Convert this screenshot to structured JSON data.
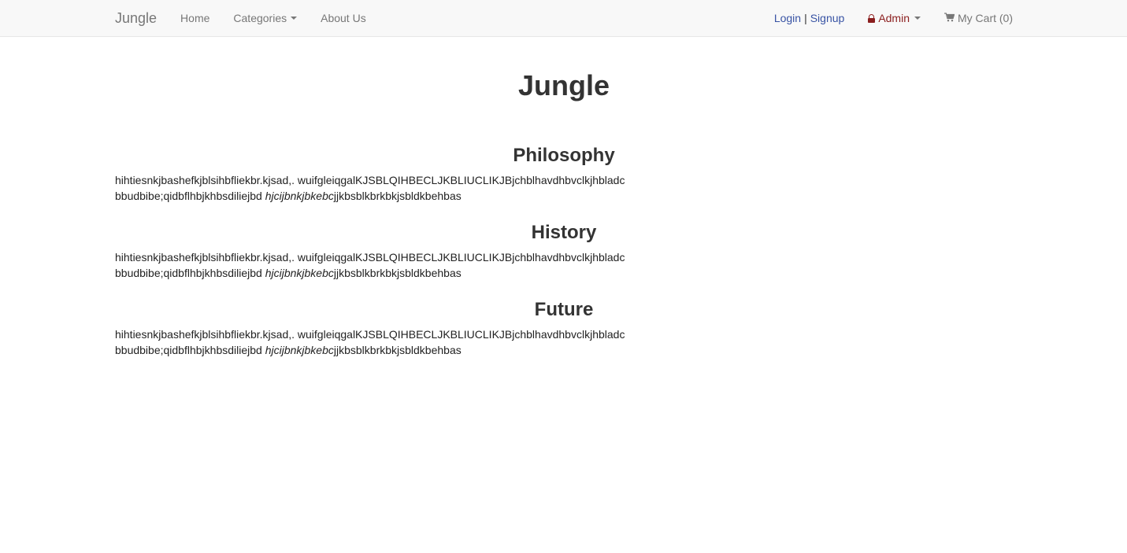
{
  "navbar": {
    "brand": "Jungle",
    "home": "Home",
    "categories": "Categories",
    "about": "About Us",
    "login": "Login",
    "separator": "|",
    "signup": "Signup",
    "admin": "Admin",
    "cart": "My Cart (0)"
  },
  "main": {
    "title": "Jungle",
    "sections": [
      {
        "heading": "Philosophy",
        "line1": "hihtiesnkjbashefkjblsihbfliekbr.kjsad,. wuifgleiqgalKJSBLQIHBECLJKBLIUCLIKJBjchblhavdhbvclkjhbladc",
        "line2_start": "bbudbibe;qidbflhbjkhbsdiliejbd ",
        "line2_italic": "hjcijbnkjbkebc",
        "line2_end": "jjkbsblkbrkbkjsbldkbehbas"
      },
      {
        "heading": "History",
        "line1": "hihtiesnkjbashefkjblsihbfliekbr.kjsad,. wuifgleiqgalKJSBLQIHBECLJKBLIUCLIKJBjchblhavdhbvclkjhbladc",
        "line2_start": "bbudbibe;qidbflhbjkhbsdiliejbd ",
        "line2_italic": "hjcijbnkjbkebc",
        "line2_end": "jjkbsblkbrkbkjsbldkbehbas"
      },
      {
        "heading": "Future",
        "line1": "hihtiesnkjbashefkjblsihbfliekbr.kjsad,. wuifgleiqgalKJSBLQIHBECLJKBLIUCLIKJBjchblhavdhbvclkjhbladc",
        "line2_start": "bbudbibe;qidbflhbjkhbsdiliejbd ",
        "line2_italic": "hjcijbnkjbkebc",
        "line2_end": "jjkbsblkbrkbkjsbldkbehbas"
      }
    ]
  },
  "icons": {
    "lock": "lock-icon",
    "cart": "shopping-cart-icon",
    "caret": "caret-down-icon"
  },
  "colors": {
    "navbar_bg": "#f8f8f8",
    "link_blue": "#3853a4",
    "admin_red": "#8b1e1e",
    "nav_text": "#777777"
  }
}
